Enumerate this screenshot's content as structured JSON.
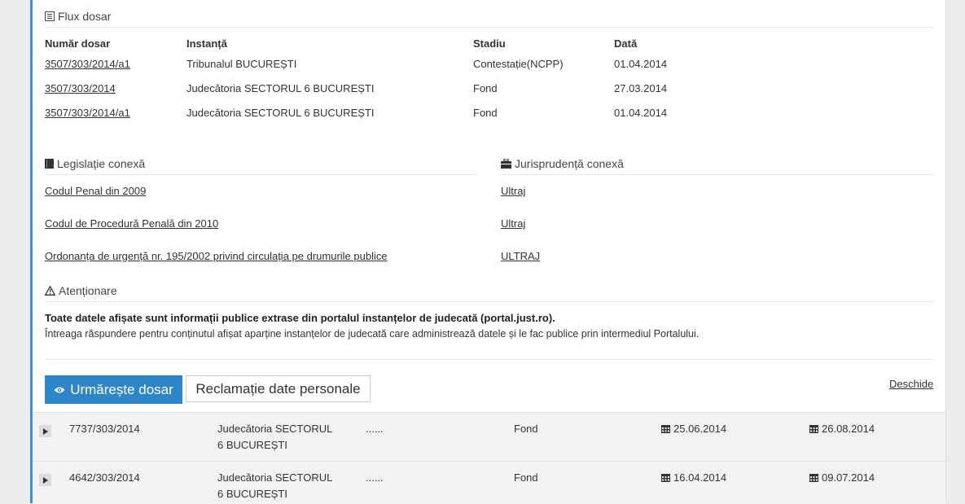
{
  "flux": {
    "title": "Flux dosar",
    "headers": [
      "Număr dosar",
      "Instanță",
      "Stadiu",
      "Dată"
    ],
    "rows": [
      {
        "numar": "3507/303/2014/a1",
        "instanta": "Tribunalul BUCUREȘTI",
        "stadiu": "Contestație(NCPP)",
        "data": "01.04.2014"
      },
      {
        "numar": "3507/303/2014",
        "instanta": "Judecătoria SECTORUL 6 BUCUREȘTI",
        "stadiu": "Fond",
        "data": "27.03.2014"
      },
      {
        "numar": "3507/303/2014/a1",
        "instanta": "Judecătoria SECTORUL 6 BUCUREȘTI",
        "stadiu": "Fond",
        "data": "01.04.2014"
      }
    ]
  },
  "legislatie": {
    "title": "Legislație conexă",
    "items": [
      "Codul Penal din 2009",
      "Codul de Procedură Penală din 2010",
      "Ordonanța de urgență nr. 195/2002 privind circulația pe drumurile publice"
    ]
  },
  "jurisprudenta": {
    "title": "Jurisprudență conexă",
    "items": [
      "Ultraj",
      "Ultraj",
      "ULTRAJ"
    ]
  },
  "atentionare": {
    "title": "Atenționare",
    "bold_text": "Toate datele afișate sunt informații publice extrase din portalul instanțelor de judecată (portal.just.ro).",
    "text": "Întreaga răspundere pentru conținutul afișat aparține instanțelor de judecată care administrează datele și le fac publice prin intermediul Portalului."
  },
  "actions": {
    "follow_label": "Urmărește dosar",
    "claim_label": "Reclamație date personale",
    "open_link": "Deschide"
  },
  "results": [
    {
      "numar": "7737/303/2014",
      "instanta_line1": "Judecătoria SECTORUL",
      "instanta_line2": "6 BUCUREȘTI",
      "obiect": "......",
      "stadiu": "Fond",
      "data1": "25.06.2014",
      "data2": "26.08.2014"
    },
    {
      "numar": "4642/303/2014",
      "instanta_line1": "Judecătoria SECTORUL",
      "instanta_line2": "6 BUCUREȘTI",
      "obiect": "......",
      "stadiu": "Fond",
      "data1": "16.04.2014",
      "data2": "09.07.2014"
    }
  ],
  "colors": {
    "accent": "#2e86c8",
    "left_border": "#3a8fd6"
  }
}
